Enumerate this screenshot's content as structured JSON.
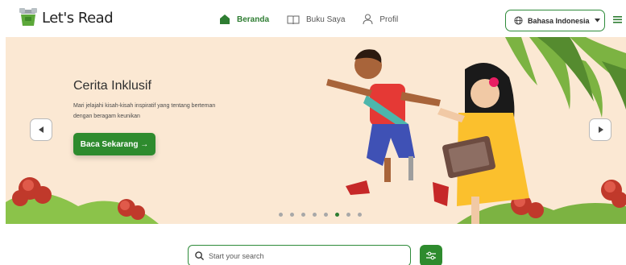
{
  "header": {
    "logo_text": "Let's Read",
    "nav": [
      {
        "label": "Beranda",
        "icon": "home-icon",
        "active": true
      },
      {
        "label": "Buku Saya",
        "icon": "book-icon",
        "active": false
      },
      {
        "label": "Profil",
        "icon": "user-icon",
        "active": false
      }
    ],
    "language_label": "Bahasa Indonesia",
    "menu_icon": "hamburger-icon"
  },
  "hero": {
    "title": "Cerita Inklusif",
    "description": "Mari jelajahi kisah-kisah inspiratif yang tentang berteman dengan beragam keunikan",
    "cta_label": "Baca Sekarang →",
    "prev_icon": "chevron-left-icon",
    "next_icon": "chevron-right-icon",
    "carousel": {
      "total_slides": 8,
      "active_index": 5
    }
  },
  "search": {
    "placeholder": "Start your search",
    "value": "",
    "filter_icon": "sliders-icon"
  },
  "colors": {
    "brand_green": "#2e8b2e",
    "hero_background": "#fbe8d3",
    "active_nav": "#2e7d32"
  }
}
